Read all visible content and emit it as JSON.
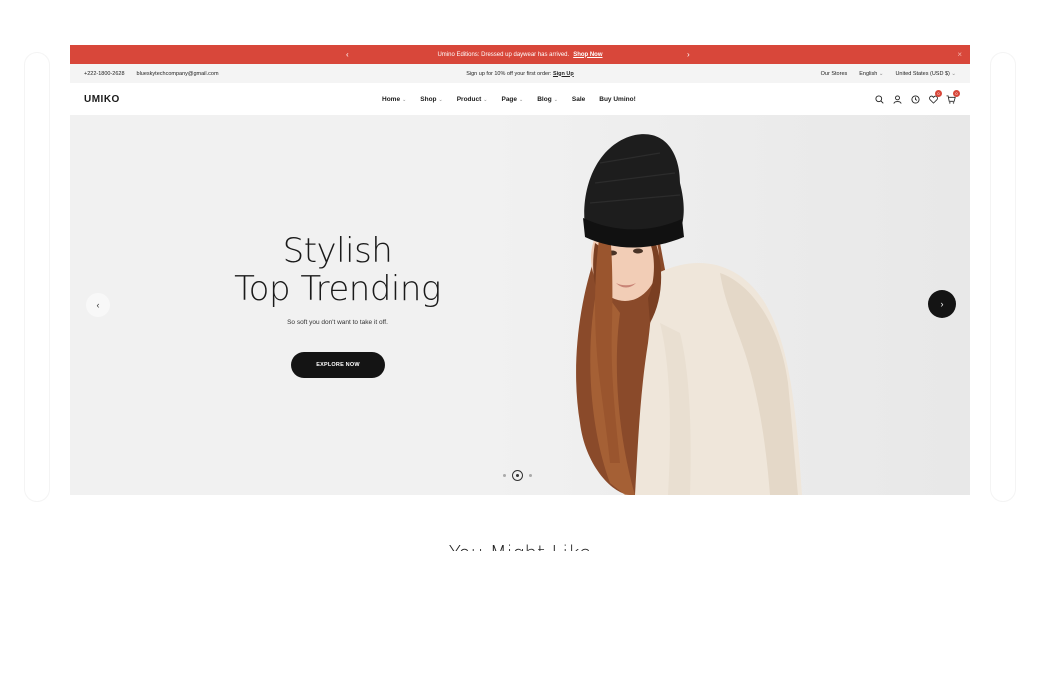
{
  "announcement": {
    "prev_arrow": "‹",
    "next_arrow": "›",
    "message": "Umino Editions: Dressed up daywear has arrived.",
    "link": "Shop Now",
    "close": "×"
  },
  "topbar": {
    "phone": "+222-1800-2628",
    "email": "blueskytechcompany@gmail.com",
    "promo": "Sign up for 10% off your first order:",
    "promo_link": "Sign Up",
    "stores": "Our Stores",
    "language": "English",
    "currency": "United States (USD $)"
  },
  "nav": {
    "logo": "UMIKO",
    "items": [
      {
        "label": "Home",
        "caret": "⌄"
      },
      {
        "label": "Shop",
        "caret": "⌄"
      },
      {
        "label": "Product",
        "caret": "⌄"
      },
      {
        "label": "Page",
        "caret": "⌄"
      },
      {
        "label": "Blog",
        "caret": "⌄"
      },
      {
        "label": "Sale",
        "caret": ""
      },
      {
        "label": "Buy Umino!",
        "caret": ""
      }
    ],
    "wishlist_count": "0",
    "cart_count": "0"
  },
  "hero": {
    "title_line1": "Stylish",
    "title_line2": "Top Trending",
    "subtitle": "So soft you don't want to take it off.",
    "cta": "EXPLORE NOW",
    "prev": "‹",
    "next": "›"
  },
  "section": {
    "title": "You Might Like"
  },
  "colors": {
    "accent": "#d8473a",
    "dark": "#141414",
    "hero_bg": "#f1f1f1"
  }
}
